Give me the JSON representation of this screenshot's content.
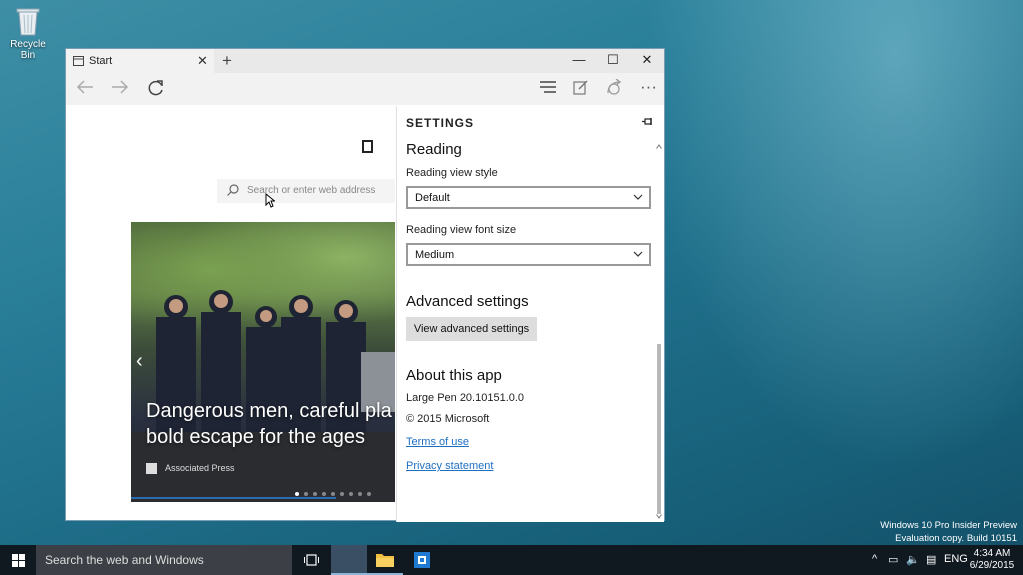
{
  "desktop": {
    "recycle_bin_label": "Recycle Bin",
    "watermark_line1": "Windows 10 Pro Insider Preview",
    "watermark_line2": "Evaluation copy. Build 10151"
  },
  "browser": {
    "tab_title": "Start",
    "search_placeholder": "Search or enter web address",
    "hero": {
      "headline_line1": "Dangerous men, careful pla",
      "headline_line2": "bold escape for the ages",
      "source": "Associated Press"
    }
  },
  "settings": {
    "header": "SETTINGS",
    "reading_section": "Reading",
    "reading_view_style_label": "Reading view style",
    "reading_view_style_value": "Default",
    "reading_view_font_size_label": "Reading view font size",
    "reading_view_font_size_value": "Medium",
    "advanced_section": "Advanced settings",
    "view_advanced_button": "View advanced settings",
    "about_section": "About this app",
    "app_version": "Large Pen 20.10151.0.0",
    "copyright": "© 2015 Microsoft",
    "terms_link": "Terms of use",
    "privacy_link": "Privacy statement"
  },
  "taskbar": {
    "search_placeholder": "Search the web and Windows",
    "language": "ENG",
    "time": "4:34 AM",
    "date": "6/29/2015"
  },
  "colors": {
    "accent_link": "#1f6fc1",
    "taskbar_bg": "#101820"
  }
}
